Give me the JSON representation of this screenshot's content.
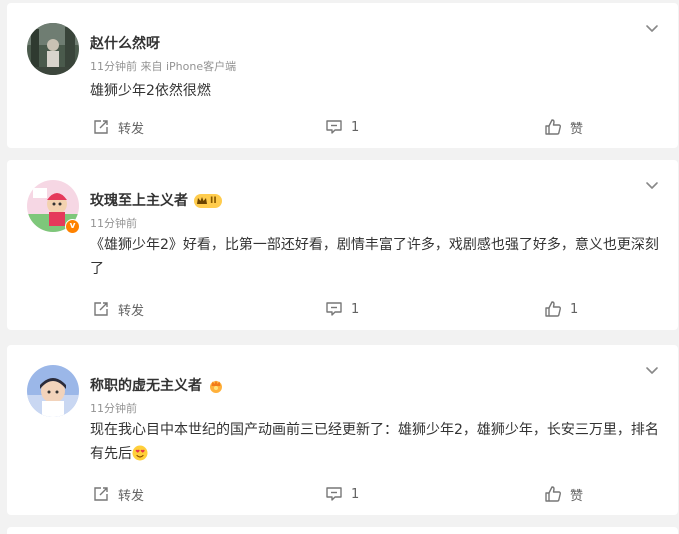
{
  "comments": [
    {
      "user": "赵什么然呀",
      "meta": "11分钟前 来自 iPhone客户端",
      "text": "雄狮少年2依然很燃",
      "share_label": "转发",
      "comment_count": "1",
      "like_label": "赞"
    },
    {
      "user": "玫瑰至上主义者",
      "level_text": "II",
      "meta": "11分钟前",
      "text": "《雄狮少年2》好看，比第一部还好看，剧情丰富了许多，戏剧感也强了好多，意义也更深刻了",
      "share_label": "转发",
      "comment_count": "1",
      "like_label": "1"
    },
    {
      "user": "称职的虚无主义者",
      "meta": "11分钟前",
      "text": "现在我心目中本世纪的国产动画前三已经更新了：雄狮少年2，雄狮少年，长安三万里，排名有先后",
      "share_label": "转发",
      "comment_count": "1",
      "like_label": "赞"
    }
  ],
  "icons": {
    "share": "share-icon",
    "comment": "comment-icon",
    "like": "thumbs-up-icon",
    "more": "chevron-down-icon",
    "verified": "verified-v-icon",
    "crown": "crown-icon",
    "emoji": "heart-eyes-emoji-icon"
  },
  "colors": {
    "background": "#f2f2f2",
    "card": "#ffffff",
    "meta_text": "#939393",
    "verified": "#ff8200",
    "level_badge": "#ffcc4d"
  }
}
